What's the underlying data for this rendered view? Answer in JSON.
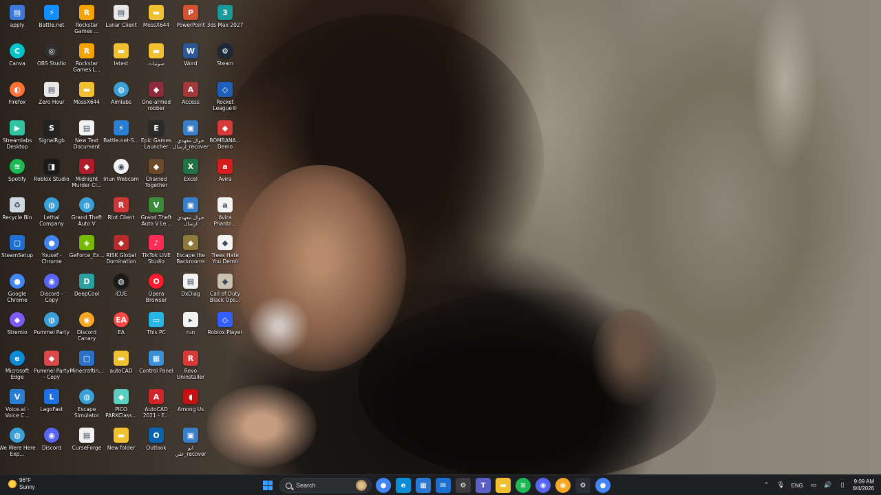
{
  "desktop": {
    "icons": [
      {
        "label": "apply",
        "icon": "document-icon",
        "color": "#3b78d8"
      },
      {
        "label": "Battle.net",
        "icon": "battlenet-icon",
        "color": "#148eff"
      },
      {
        "label": "Rockstar Games ...",
        "icon": "rockstar-icon",
        "color": "#f5a300"
      },
      {
        "label": "Lunar Client",
        "icon": "document-icon",
        "color": "#e8e8e8"
      },
      {
        "label": "MossX644",
        "icon": "folder-icon",
        "color": "#f0c030"
      },
      {
        "label": "PowerPoint",
        "icon": "powerpoint-icon",
        "color": "#d35230"
      },
      {
        "label": "3ds Max 2027",
        "icon": "3dsmax-icon",
        "color": "#1a9a9a"
      },
      {
        "label": "Canva",
        "icon": "canva-icon",
        "color": "#00c4cc"
      },
      {
        "label": "OBS Studio",
        "icon": "obs-icon",
        "color": "#302e31"
      },
      {
        "label": "Rockstar Games L...",
        "icon": "rockstar-icon",
        "color": "#f5a300"
      },
      {
        "label": "latest",
        "icon": "folder-icon",
        "color": "#f0c030"
      },
      {
        "label": "صوتيات",
        "icon": "folder-icon",
        "color": "#f0c030"
      },
      {
        "label": "Word",
        "icon": "word-icon",
        "color": "#2b5797"
      },
      {
        "label": "Steam",
        "icon": "steam-icon",
        "color": "#1b2838"
      },
      {
        "label": "Firefox",
        "icon": "firefox-icon",
        "color": "#ff7139"
      },
      {
        "label": "Zero Hour",
        "icon": "document-icon",
        "color": "#e8e8e8"
      },
      {
        "label": "MossX644",
        "icon": "folder-icon",
        "color": "#f0c030"
      },
      {
        "label": "Aimlabs",
        "icon": "globe-icon",
        "color": "#3ba0d8"
      },
      {
        "label": "One-armed robber",
        "icon": "game-icon",
        "color": "#8a2a3a"
      },
      {
        "label": "Access",
        "icon": "access-icon",
        "color": "#a4373a"
      },
      {
        "label": "Rocket League®",
        "icon": "rocket-league-icon",
        "color": "#1c5fb8"
      },
      {
        "label": "Streamlabs Desktop",
        "icon": "streamlabs-icon",
        "color": "#31c3a2"
      },
      {
        "label": "SignalRgb",
        "icon": "signalrgb-icon",
        "color": "#222"
      },
      {
        "label": "New Text Document",
        "icon": "document-icon",
        "color": "#f2f2f2"
      },
      {
        "label": "Battle.net-S...",
        "icon": "battlenet-icon",
        "color": "#2a7fd4"
      },
      {
        "label": "Epic Games Launcher",
        "icon": "epic-icon",
        "color": "#2a2a2a"
      },
      {
        "label": "جوال معهدي ارسال_recover",
        "icon": "app-icon",
        "color": "#3a7ec8"
      },
      {
        "label": "BOMBANA... Demo",
        "icon": "game-icon",
        "color": "#d63a3a"
      },
      {
        "label": "Spotify",
        "icon": "spotify-icon",
        "color": "#1db954"
      },
      {
        "label": "Roblox Studio",
        "icon": "roblox-studio-icon",
        "color": "#1a1a1a"
      },
      {
        "label": "Midnight Murder Cl...",
        "icon": "game-icon",
        "color": "#b01c2c"
      },
      {
        "label": "Iriun Webcam",
        "icon": "webcam-icon",
        "color": "#f4f4f4"
      },
      {
        "label": "Chained Together",
        "icon": "game-icon",
        "color": "#6a4a2a"
      },
      {
        "label": "Excel",
        "icon": "excel-icon",
        "color": "#217346"
      },
      {
        "label": "Avira",
        "icon": "avira-icon",
        "color": "#d51b1b"
      },
      {
        "label": "Recycle Bin",
        "icon": "recycle-bin-icon",
        "color": "#cfd8e0"
      },
      {
        "label": "Lethal Company",
        "icon": "globe-icon",
        "color": "#3ba0d8"
      },
      {
        "label": "Grand Theft Auto V",
        "icon": "globe-icon",
        "color": "#3ba0d8"
      },
      {
        "label": "Riot Client",
        "icon": "riot-icon",
        "color": "#d13639"
      },
      {
        "label": "Grand Theft Auto V Le...",
        "icon": "gta-icon",
        "color": "#3a8a3a"
      },
      {
        "label": "جوال معهدي ارسال",
        "icon": "app-icon",
        "color": "#3a7ec8"
      },
      {
        "label": "Avira Phanto...",
        "icon": "avira-icon",
        "color": "#f2f2f2"
      },
      {
        "label": "SteamSetup",
        "icon": "installer-icon",
        "color": "#1f6fd0"
      },
      {
        "label": "Yousef - Chrome",
        "icon": "chrome-icon",
        "color": "#4285f4"
      },
      {
        "label": "GeForce_Ex...",
        "icon": "nvidia-icon",
        "color": "#76b900"
      },
      {
        "label": "RISK Global Domination",
        "icon": "game-icon",
        "color": "#b82c2c"
      },
      {
        "label": "TikTok LIVE Studio",
        "icon": "tiktok-icon",
        "color": "#fe2c55"
      },
      {
        "label": "Escape the Backrooms",
        "icon": "game-icon",
        "color": "#8c7a3a"
      },
      {
        "label": "Trees Hate You Demo",
        "icon": "game-icon",
        "color": "#f2f2f2"
      },
      {
        "label": "Google Chrome",
        "icon": "chrome-icon",
        "color": "#4285f4"
      },
      {
        "label": "Discord - Copy",
        "icon": "discord-icon",
        "color": "#5865f2"
      },
      {
        "label": "DeepCool",
        "icon": "deepcool-icon",
        "color": "#2aa0a0"
      },
      {
        "label": "iCUE",
        "icon": "icue-icon",
        "color": "#1a1a1a"
      },
      {
        "label": "Opera Browser",
        "icon": "opera-icon",
        "color": "#ff1b2d"
      },
      {
        "label": "DxDiag",
        "icon": "document-icon",
        "color": "#f2f2f2"
      },
      {
        "label": "Call of Duty Black Ops...",
        "icon": "game-icon",
        "color": "#c8c0b0"
      },
      {
        "label": "Stremio",
        "icon": "stremio-icon",
        "color": "#7b5bf5"
      },
      {
        "label": "Pummel Party",
        "icon": "globe-icon",
        "color": "#3ba0d8"
      },
      {
        "label": "Discord Canary",
        "icon": "discord-canary-icon",
        "color": "#f5a623"
      },
      {
        "label": "EA",
        "icon": "ea-icon",
        "color": "#ff4747"
      },
      {
        "label": "This PC",
        "icon": "this-pc-icon",
        "color": "#27b6e8"
      },
      {
        "label": "run",
        "icon": "run-icon",
        "color": "#f2f2f2"
      },
      {
        "label": "Roblox Player",
        "icon": "roblox-icon",
        "color": "#335fff"
      },
      {
        "label": "Microsoft Edge",
        "icon": "edge-icon",
        "color": "#0c8bd6"
      },
      {
        "label": "Pummel Party - Copy",
        "icon": "game-icon",
        "color": "#d84a4a"
      },
      {
        "label": "Minecraftin...",
        "icon": "installer-icon",
        "color": "#2a6fc8"
      },
      {
        "label": "autoCAD",
        "icon": "folder-icon",
        "color": "#f0c030"
      },
      {
        "label": "Control Panel",
        "icon": "control-panel-icon",
        "color": "#3a8fd8"
      },
      {
        "label": "Revo Uninstaller",
        "icon": "revo-icon",
        "color": "#d83a3a"
      },
      {
        "label": "Voice.ai - Voice C...",
        "icon": "voiceai-icon",
        "color": "#2a7fd4"
      },
      {
        "label": "LagoFast",
        "icon": "lagofast-icon",
        "color": "#1f6fe0"
      },
      {
        "label": "Escape Simulator",
        "icon": "globe-icon",
        "color": "#3ba0d8"
      },
      {
        "label": "PICO PARKClass...",
        "icon": "game-icon",
        "color": "#5ad0c0"
      },
      {
        "label": "AutoCAD 2021 - E...",
        "icon": "autocad-icon",
        "color": "#d0252b"
      },
      {
        "label": "Among Us",
        "icon": "among-us-icon",
        "color": "#c51111"
      },
      {
        "label": "We Were Here Exp...",
        "icon": "globe-icon",
        "color": "#3ba0d8"
      },
      {
        "label": "Discord",
        "icon": "discord-icon",
        "color": "#5865f2"
      },
      {
        "label": "CurseForge",
        "icon": "document-icon",
        "color": "#f2f2f2"
      },
      {
        "label": "New folder",
        "icon": "folder-icon",
        "color": "#f0c030"
      },
      {
        "label": "Outlook",
        "icon": "outlook-icon",
        "color": "#0a64ad"
      },
      {
        "label": "ابو علي_recover",
        "icon": "app-icon",
        "color": "#3a7ec8"
      }
    ]
  },
  "taskbar": {
    "weather": {
      "temp": "96°F",
      "condition": "Sunny"
    },
    "search_label": "Search",
    "apps": [
      {
        "name": "chrome",
        "icon": "chrome-icon",
        "color": "#4285f4",
        "glyph": "●"
      },
      {
        "name": "edge",
        "icon": "edge-icon",
        "color": "#0c8bd6",
        "glyph": "e"
      },
      {
        "name": "calendar-app",
        "icon": "calendar-icon",
        "color": "#2a78d4",
        "glyph": "▦"
      },
      {
        "name": "mail-app",
        "icon": "mail-icon",
        "color": "#1a6fd0",
        "glyph": "✉"
      },
      {
        "name": "settings",
        "icon": "gear-icon",
        "color": "#3c3c40",
        "glyph": "⚙"
      },
      {
        "name": "teams",
        "icon": "teams-icon",
        "color": "#5b5fc7",
        "glyph": "T"
      },
      {
        "name": "file-explorer",
        "icon": "folder-icon",
        "color": "#f0c030",
        "glyph": "▬"
      },
      {
        "name": "spotify",
        "icon": "spotify-icon",
        "color": "#1db954",
        "glyph": "≋"
      },
      {
        "name": "discord",
        "icon": "discord-icon",
        "color": "#5865f2",
        "glyph": "◉"
      },
      {
        "name": "discord-canary",
        "icon": "discord-canary-icon",
        "color": "#f5a623",
        "glyph": "◉"
      },
      {
        "name": "steam",
        "icon": "steam-icon",
        "color": "#2a2d33",
        "glyph": "⚙"
      },
      {
        "name": "chrome-profile",
        "icon": "chrome-icon",
        "color": "#4285f4",
        "glyph": "●"
      }
    ],
    "tray": {
      "language": "ENG",
      "time": "9:09 AM",
      "date": "8/4/2026"
    }
  }
}
